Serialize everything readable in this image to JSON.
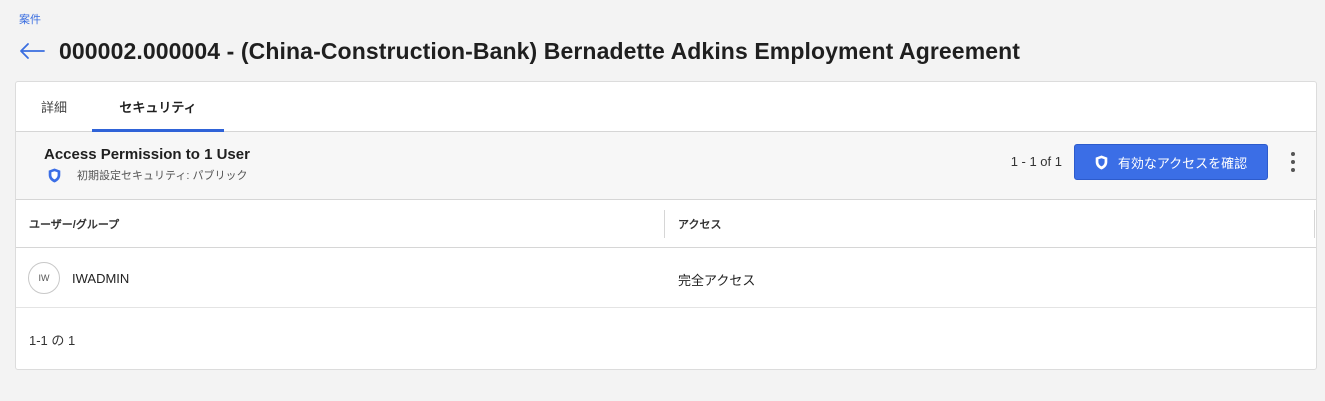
{
  "breadcrumb": "案件",
  "page_title": "000002.000004 - (China-Construction-Bank) Bernadette Adkins Employment Agreement",
  "tabs": [
    {
      "label": "詳細"
    },
    {
      "label": "セキュリティ",
      "active": true
    }
  ],
  "summary": {
    "title": "Access Permission to 1 User",
    "default_security": "初期設定セキュリティ: パブリック",
    "pager_count": "1 - 1 of 1",
    "verify_button": "有効なアクセスを確認"
  },
  "table": {
    "columns": [
      "ユーザー/グループ",
      "アクセス"
    ],
    "rows": [
      {
        "avatar_initials": "IW",
        "name": "IWADMIN",
        "access": "完全アクセス"
      }
    ]
  },
  "footer_count": "1-1 の 1",
  "colors": {
    "accent": "#3b6ee6",
    "link": "#3a6ee0",
    "background": "#f3f3f3"
  },
  "icons": {
    "back": "arrow-left-icon",
    "shield": "shield-icon",
    "more": "more-vertical-icon"
  }
}
